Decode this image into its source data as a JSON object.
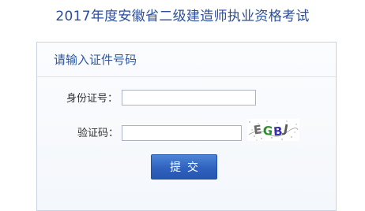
{
  "page": {
    "title": "2017年度安徽省二级建造师执业资格考试"
  },
  "form": {
    "heading": "请输入证件号码",
    "id_number": {
      "label": "身份证号：",
      "value": "",
      "placeholder": ""
    },
    "captcha": {
      "label": "验证码：",
      "value": "",
      "placeholder": "",
      "image_text": "EGBJ"
    },
    "submit_label": "提交"
  },
  "colors": {
    "title": "#2a4e9b",
    "panel_border": "#c9d3e2",
    "button": "#2f62be"
  }
}
